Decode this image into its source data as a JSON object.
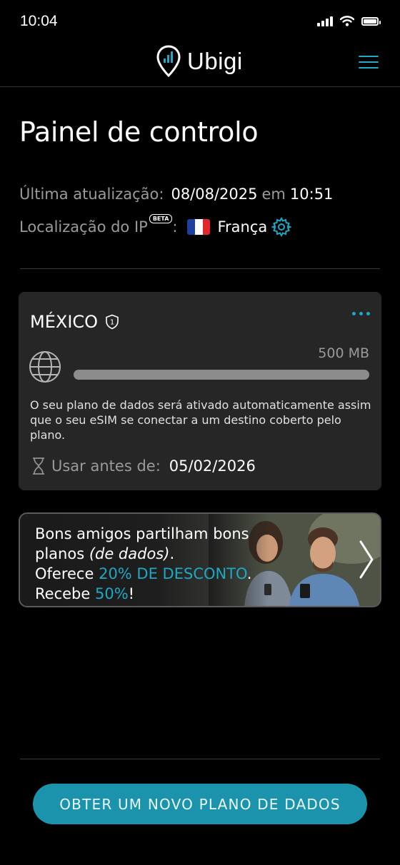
{
  "status_bar": {
    "time": "10:04"
  },
  "header": {
    "logo_text": "Ubigi"
  },
  "page": {
    "title": "Painel de controlo"
  },
  "info": {
    "last_update_label": "Última atualização:",
    "last_update_date": "08/08/2025",
    "last_update_sep": "em",
    "last_update_time": "10:51",
    "ip_location_label": "Localização do IP",
    "beta_badge": "BETA",
    "ip_location_colon": ":",
    "country": "França"
  },
  "plan": {
    "country": "MÉXICO",
    "badge_number": "1",
    "amount": "500 MB",
    "usage_fraction": 0,
    "description": "O seu plano de dados será ativado automaticamente assim que o seu eSIM se conectar a um destino coberto pelo plano.",
    "use_before_label": "Usar antes de:",
    "use_before_date": "05/02/2026"
  },
  "promo": {
    "line1_a": "Bons amigos partilham ",
    "line1_b": "bons",
    "line2_a": "planos ",
    "line2_b": "(de dados)",
    "line2_c": ".",
    "line3_a": "Oferece ",
    "line3_b": "20% DE DESCONTO",
    "line3_c": ".",
    "line4_a": "Recebe ",
    "line4_b": "50%",
    "line4_c": "!"
  },
  "cta": {
    "label": "OBTER UM NOVO PLANO DE DADOS"
  },
  "colors": {
    "accent": "#1ea8c4",
    "cta": "#1b93ac",
    "card": "#262626",
    "background": "#000000"
  },
  "icons": [
    "signal-icon",
    "wifi-icon",
    "battery-icon",
    "logo-pin-icon",
    "menu-icon",
    "flag-france-icon",
    "gear-icon",
    "shield-icon",
    "more-icon",
    "globe-icon",
    "hourglass-icon",
    "chevron-right-icon"
  ]
}
